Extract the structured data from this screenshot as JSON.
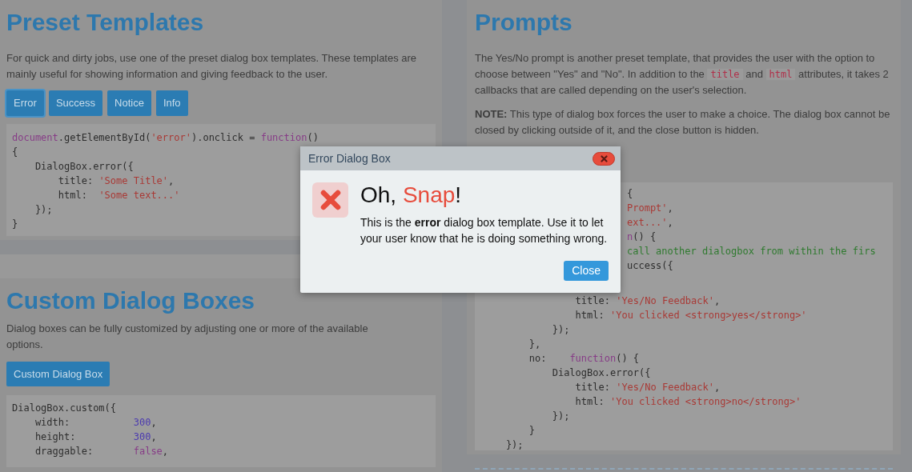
{
  "preset_templates": {
    "heading": "Preset Templates",
    "description": "For quick and dirty jobs, use one of the preset dialog box templates. These templates are mainly useful for showing information and giving feedback to the user.",
    "buttons": [
      {
        "label": "Error",
        "focused": true
      },
      {
        "label": "Success",
        "focused": false
      },
      {
        "label": "Notice",
        "focused": false
      },
      {
        "label": "Info",
        "focused": false
      }
    ],
    "code": [
      [
        {
          "text": "document",
          "kind": "keyword"
        },
        {
          "text": ".getElementById(",
          "kind": "plain"
        },
        {
          "text": "'error'",
          "kind": "string"
        },
        {
          "text": ").onclick = ",
          "kind": "plain"
        },
        {
          "text": "function",
          "kind": "keyword"
        },
        {
          "text": "()",
          "kind": "plain"
        }
      ],
      [
        {
          "text": "{",
          "kind": "plain"
        }
      ],
      [
        {
          "text": "    DialogBox.error({",
          "kind": "plain"
        }
      ],
      [
        {
          "text": "        title: ",
          "kind": "plain"
        },
        {
          "text": "'Some Title'",
          "kind": "string"
        },
        {
          "text": ",",
          "kind": "plain"
        }
      ],
      [
        {
          "text": "        html:  ",
          "kind": "plain"
        },
        {
          "text": "'Some text...'",
          "kind": "string"
        }
      ],
      [
        {
          "text": "    });",
          "kind": "plain"
        }
      ],
      [
        {
          "text": "}",
          "kind": "plain"
        }
      ]
    ]
  },
  "custom_dialog_boxes": {
    "heading": "Custom Dialog Boxes",
    "description": "Dialog boxes can be fully customized by adjusting one or more of the available options.",
    "button": "Custom Dialog Box",
    "code": [
      [
        {
          "text": "DialogBox.custom({",
          "kind": "plain"
        }
      ],
      [
        {
          "text": "    width:           ",
          "kind": "plain"
        },
        {
          "text": "300",
          "kind": "number"
        },
        {
          "text": ",",
          "kind": "plain"
        }
      ],
      [
        {
          "text": "    height:          ",
          "kind": "plain"
        },
        {
          "text": "300",
          "kind": "number"
        },
        {
          "text": ",",
          "kind": "plain"
        }
      ],
      [
        {
          "text": "    draggable:       ",
          "kind": "plain"
        },
        {
          "text": "false",
          "kind": "keyword"
        },
        {
          "text": ",",
          "kind": "plain"
        }
      ]
    ]
  },
  "prompts": {
    "heading": "Prompts",
    "description": [
      {
        "text": "The Yes/No prompt is another preset template, that provides the user with the option to choose between \"Yes\" and \"No\". In addition to the ",
        "kind": "plain"
      },
      {
        "text": "title",
        "kind": "code"
      },
      {
        "text": " and ",
        "kind": "plain"
      },
      {
        "text": "html",
        "kind": "code"
      },
      {
        "text": " attributes, it takes 2 callbacks that are called depending on the user's selection.",
        "kind": "plain"
      }
    ],
    "note": "**NOTE:** This type of dialog box forces the user to make a choice. The dialog box cannot be closed by clicking outside of it, and the close button is hidden.",
    "code_beside_dialog": [
      [
        {
          "text": "{",
          "kind": "plain"
        }
      ],
      [
        {
          "text": "Prompt'",
          "kind": "string"
        },
        {
          "text": ",",
          "kind": "plain"
        }
      ],
      [
        {
          "text": "ext...'",
          "kind": "string"
        },
        {
          "text": ",",
          "kind": "plain"
        }
      ],
      [
        {
          "text": "n",
          "kind": "keyword"
        },
        {
          "text": "() {",
          "kind": "plain"
        }
      ],
      [
        {
          "text": "call another dialogbox from within the firs",
          "kind": "comment"
        }
      ],
      [
        {
          "text": "uccess({",
          "kind": "plain"
        }
      ]
    ],
    "code_below_dialog": [
      [
        {
          "text": "                title: ",
          "kind": "plain"
        },
        {
          "text": "'Yes/No Feedback'",
          "kind": "string"
        },
        {
          "text": ",",
          "kind": "plain"
        }
      ],
      [
        {
          "text": "                html: ",
          "kind": "plain"
        },
        {
          "text": "'You clicked <strong>yes</strong>'",
          "kind": "string"
        }
      ],
      [
        {
          "text": "            });",
          "kind": "plain"
        }
      ],
      [
        {
          "text": "        },",
          "kind": "plain"
        }
      ],
      [
        {
          "text": "        no:    ",
          "kind": "plain"
        },
        {
          "text": "function",
          "kind": "keyword"
        },
        {
          "text": "() {",
          "kind": "plain"
        }
      ],
      [
        {
          "text": "            DialogBox.error({",
          "kind": "plain"
        }
      ],
      [
        {
          "text": "                title: ",
          "kind": "plain"
        },
        {
          "text": "'Yes/No Feedback'",
          "kind": "string"
        },
        {
          "text": ",",
          "kind": "plain"
        }
      ],
      [
        {
          "text": "                html: ",
          "kind": "plain"
        },
        {
          "text": "'You clicked <strong>no</strong>'",
          "kind": "string"
        }
      ],
      [
        {
          "text": "            });",
          "kind": "plain"
        }
      ],
      [
        {
          "text": "        }",
          "kind": "plain"
        }
      ],
      [
        {
          "text": "    });",
          "kind": "plain"
        }
      ]
    ]
  },
  "dialog": {
    "title": "Error Dialog Box",
    "heading": [
      {
        "text": "Oh, ",
        "kind": "plain"
      },
      {
        "text": "Snap",
        "kind": "accent"
      },
      {
        "text": "!",
        "kind": "plain"
      }
    ],
    "message": "This is the **error** dialog box template. Use it to let your user know that he is doing something wrong.",
    "button": "Close"
  }
}
